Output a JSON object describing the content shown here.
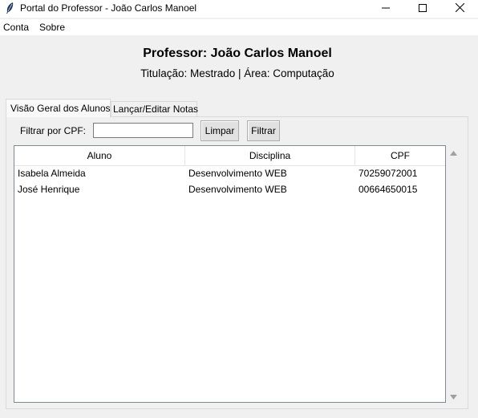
{
  "window": {
    "title": "Portal do Professor - João Carlos Manoel",
    "icons": {
      "app": "feather-icon",
      "minimize": "minimize-icon",
      "maximize": "maximize-icon",
      "close": "close-icon"
    }
  },
  "menu": {
    "items": [
      {
        "label": "Conta"
      },
      {
        "label": "Sobre"
      }
    ]
  },
  "header": {
    "professor": "Professor: João Carlos Manoel",
    "details": "Titulação: Mestrado | Área: Computação"
  },
  "tabs": [
    {
      "label": "Visão Geral dos Alunos",
      "active": true
    },
    {
      "label": "Lançar/Editar Notas",
      "active": false
    }
  ],
  "filter": {
    "label": "Filtrar por CPF:",
    "value": "",
    "clear_button": "Limpar",
    "filter_button": "Filtrar"
  },
  "table": {
    "columns": [
      "Aluno",
      "Disciplina",
      "CPF"
    ],
    "rows": [
      {
        "aluno": "Isabela Almeida",
        "disciplina": "Desenvolvimento WEB",
        "cpf": "70259072001"
      },
      {
        "aluno": "José Henrique",
        "disciplina": "Desenvolvimento WEB",
        "cpf": "00664650015"
      }
    ]
  },
  "colors": {
    "window_bg": "#f0f0f0",
    "titlebar_bg": "#ffffff",
    "button_bg": "#e1e1e1",
    "tree_bg": "#ffffff"
  }
}
